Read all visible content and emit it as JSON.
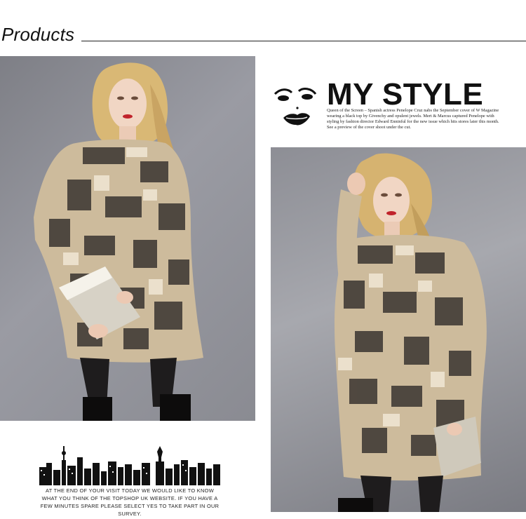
{
  "header": {
    "title": "Products"
  },
  "my_style": {
    "title": "MY STYLE",
    "text": "Queen of the Screen – Spanish actress Penelope Cruz nabs the September cover of W Magazine wearing a black top by Givenchy and opulent jewels. Mert & Marcus captured Penelope with styling by fashion director Edward Enninful for the new issue which hits stores later this month. See a preview of the cover shoot under the cut."
  },
  "survey_text": "AT THE END OF YOUR VISIT TODAY WE WOULD LIKE TO KNOW WHAT YOU THINK OF THE TOPSHOP UK WEBSITE. IF YOU HAVE A FEW MINUTES SPARE PLEASE SELECT YES TO TAKE PART IN OUR SURVEY.",
  "icons": {
    "face": "lips-face-icon",
    "skyline": "city-skyline-icon"
  },
  "colors": {
    "background": "#ffffff",
    "text": "#111111",
    "studio_gray": "#8e8f96",
    "lips": "#c0232b"
  }
}
